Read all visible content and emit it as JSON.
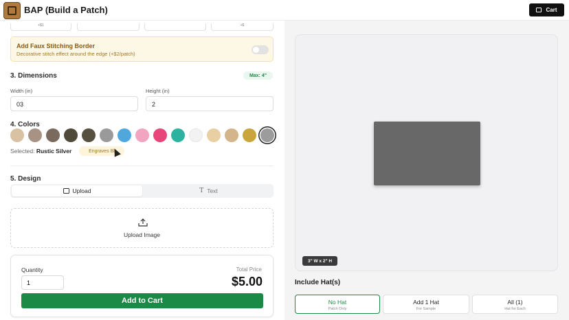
{
  "app": {
    "title": "BAP (Build a Patch)",
    "cart_label": "Cart"
  },
  "options_row": {
    "first_sub": "+$1",
    "last_sub": "+$"
  },
  "faux_stitching": {
    "title": "Add Faux Stitching Border",
    "subtitle": "Decorative stitch effect around the edge (+$2/patch)",
    "enabled": false
  },
  "dimensions": {
    "title": "3. Dimensions",
    "max_badge": "Max: 4\"",
    "width_label": "Width (in)",
    "width_value": "03",
    "height_label": "Height (in)",
    "height_value": "2"
  },
  "colors": {
    "title": "4. Colors",
    "swatches": [
      "#d9c2a4",
      "#a89283",
      "#7a6a5e",
      "#4f4a3a",
      "#55503f",
      "#9a9a9a",
      "#4ea8de",
      "#f1a5c0",
      "#e8457a",
      "#2bb3a0",
      "#f2f2f2",
      "#e9cfa4",
      "#d4b58b",
      "#c9a53c",
      "#9c9c9c"
    ],
    "selected_index": 14,
    "selected_prefix": "Selected:",
    "selected_name": "Rustic Silver",
    "engraves_badge": "Engraves Bl"
  },
  "design": {
    "title": "5. Design",
    "tab_upload": "Upload",
    "tab_text": "Text",
    "upload_label": "Upload Image"
  },
  "order": {
    "quantity_label": "Quantity",
    "quantity_value": "1",
    "total_label": "Total Price",
    "total_value": "$5.00",
    "add_to_cart": "Add to Cart"
  },
  "preview": {
    "dims_badge": "3\" W x 2\" H",
    "patch_color": "#686868"
  },
  "hats": {
    "title": "Include Hat(s)",
    "options": [
      {
        "label": "No Hat",
        "sub": "Patch Only",
        "active": true
      },
      {
        "label": "Add 1 Hat",
        "sub": "For Sample",
        "active": false
      },
      {
        "label": "All (1)",
        "sub": "Hat for Each",
        "active": false
      }
    ]
  }
}
